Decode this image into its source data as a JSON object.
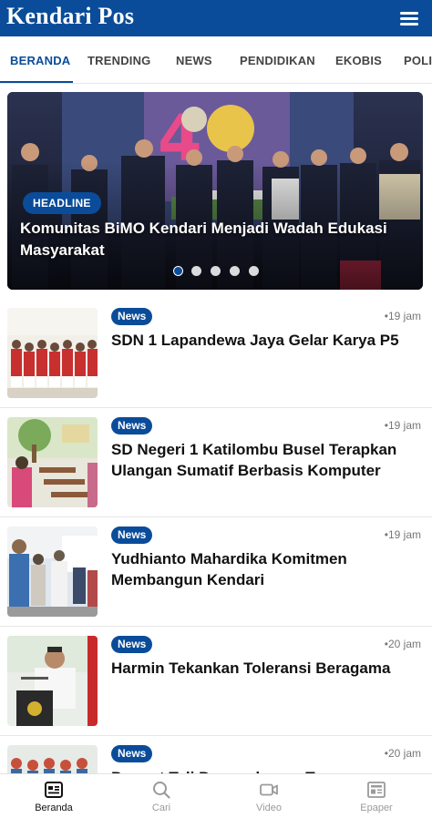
{
  "app": {
    "brand": "Kendari Pos",
    "accent": "#0a4c99"
  },
  "tabs": [
    "BERANDA",
    "TRENDING",
    "NEWS",
    "PENDIDIKAN",
    "EKOBIS",
    "POLI"
  ],
  "hero": {
    "badge": "HEADLINE",
    "title": "Komunitas BiMO Kendari Menjadi Wadah Edukasi Masyarakat",
    "slides_total": 5,
    "active_slide": 1
  },
  "news": [
    {
      "category": "News",
      "time": "•19 jam",
      "title": "SDN 1 Lapandewa Jaya Gelar Karya P5"
    },
    {
      "category": "News",
      "time": "•19 jam",
      "title": "SD Negeri 1 Katilombu Busel Terapkan Ulangan Sumatif Berbasis Komputer"
    },
    {
      "category": "News",
      "time": "•19 jam",
      "title": "Yudhianto Mahardika Komitmen Membangun Kendari"
    },
    {
      "category": "News",
      "time": "•20 jam",
      "title": "Harmin Tekankan Toleransi Beragama"
    },
    {
      "category": "News",
      "time": "•20 jam",
      "title": "Pererat Tali Persaudaraan Tanpa"
    }
  ],
  "bottom_nav": [
    {
      "label": "Beranda",
      "icon": "home-news-icon",
      "active": true
    },
    {
      "label": "Cari",
      "icon": "search-icon",
      "active": false
    },
    {
      "label": "Video",
      "icon": "video-icon",
      "active": false
    },
    {
      "label": "Epaper",
      "icon": "newspaper-icon",
      "active": false
    }
  ]
}
